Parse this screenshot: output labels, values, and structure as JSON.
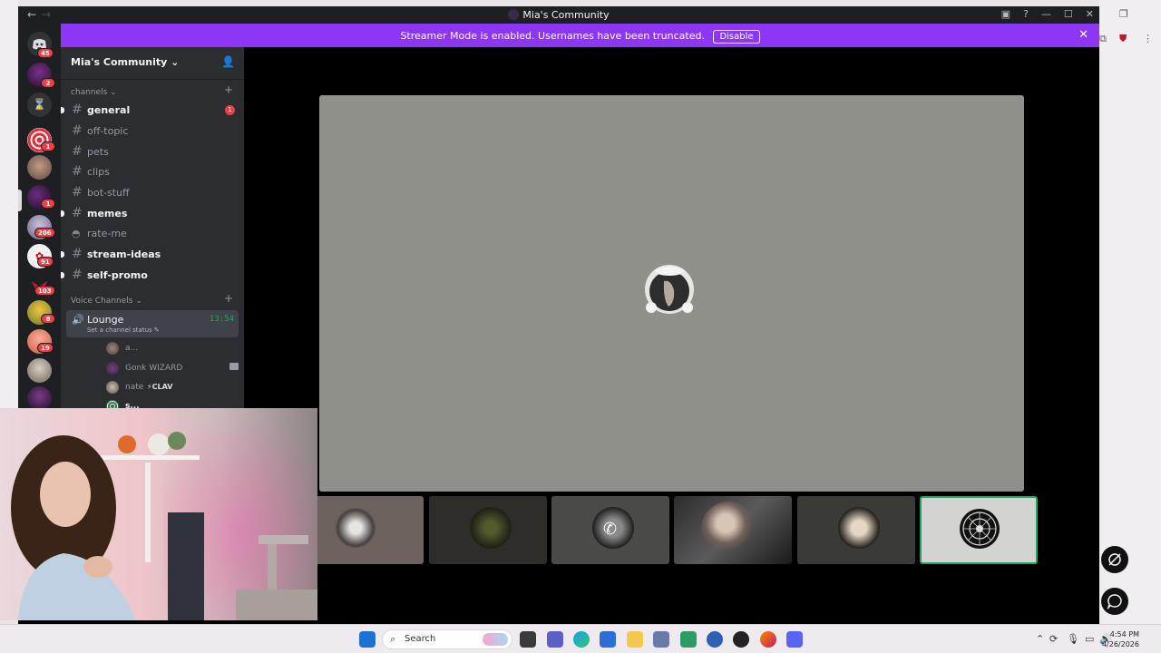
{
  "window": {
    "title": "Mia's Community",
    "back_glyph": "←",
    "forward_glyph": "→",
    "controls": [
      "▣",
      "?",
      "—",
      "☐",
      "✕"
    ]
  },
  "banner": {
    "text": "Streamer Mode is enabled. Usernames have been truncated.",
    "button": "Disable",
    "close": "✕",
    "color": "#8e36f5"
  },
  "servers": [
    {
      "name": "home",
      "badge": "45"
    },
    {
      "name": "server-1",
      "badge": "2"
    },
    {
      "name": "server-2",
      "badge": ""
    },
    {
      "name": "server-3",
      "badge": "1"
    },
    {
      "name": "server-4",
      "badge": ""
    },
    {
      "name": "server-5",
      "badge": "1"
    },
    {
      "name": "server-6",
      "badge": "206"
    },
    {
      "name": "server-7",
      "badge": "91"
    },
    {
      "name": "server-8",
      "badge": "103"
    },
    {
      "name": "server-9",
      "badge": "8"
    },
    {
      "name": "server-10",
      "badge": "19"
    },
    {
      "name": "server-11",
      "badge": ""
    },
    {
      "name": "server-12",
      "badge": ""
    }
  ],
  "guild": {
    "name": "Mia's Community",
    "chevron": "⌄",
    "text_category": "channels",
    "voice_category": "Voice Channels",
    "plus": "+",
    "channels": [
      {
        "name": "general",
        "unread": true,
        "badge": "1"
      },
      {
        "name": "off-topic",
        "unread": false,
        "badge": ""
      },
      {
        "name": "pets",
        "unread": false,
        "badge": ""
      },
      {
        "name": "clips",
        "unread": false,
        "badge": ""
      },
      {
        "name": "bot-stuff",
        "unread": false,
        "badge": ""
      },
      {
        "name": "memes",
        "unread": true,
        "badge": ""
      },
      {
        "name": "rate-me",
        "unread": false,
        "badge": ""
      },
      {
        "name": "stream-ideas",
        "unread": true,
        "badge": ""
      },
      {
        "name": "self-promo",
        "unread": true,
        "badge": ""
      }
    ],
    "voice_channel": {
      "name": "Lounge",
      "time": "13:54",
      "status": "Set a channel status"
    },
    "voice_users": [
      {
        "name": "a...",
        "tag": "",
        "camera": false
      },
      {
        "name": "Gonk WIZARD",
        "tag": "",
        "camera": true
      },
      {
        "name": "nate",
        "tag": "CLAV",
        "camera": false
      },
      {
        "name": "s...",
        "tag": "",
        "camera": false
      }
    ]
  },
  "taskbar": {
    "search": "Search",
    "time": "4:54 PM",
    "date": "4/26/2026"
  }
}
